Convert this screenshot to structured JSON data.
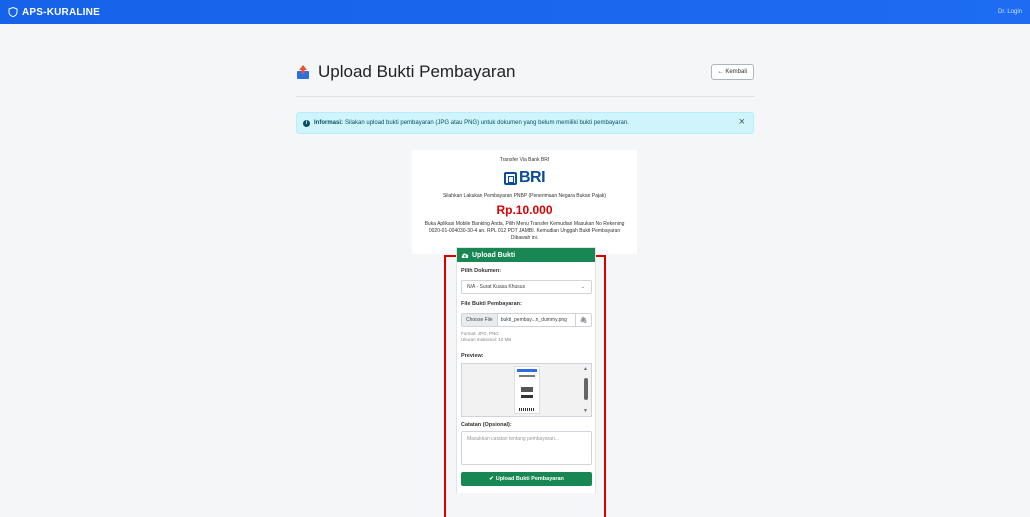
{
  "navbar": {
    "brand": "APS-KURALINE",
    "user": "Dr. Login"
  },
  "header": {
    "title": "Upload Bukti Pembayaran",
    "back_label": "← Kembali"
  },
  "alert": {
    "prefix": "Informasi:",
    "message": "Silakan upload bukti pembayaran (JPG atau PNG) untuk dokumen yang belum memiliki bukti pembayaran.",
    "close": "×"
  },
  "payment": {
    "heading": "Transfer Via Bank BRI",
    "bank_logo": "BRI",
    "description": "Silahkan Lakukan Pembayaran PNBP (Penerimaan Negara Bukan Pajak)",
    "amount": "Rp.10.000",
    "instructions": "Buka Aplikasi Mobile Banking Anda, Pilih Menu Transfer Kemudian Masukan No Rekening 0020-01-004030-30-4 an. RPL 012 PDT JAMBI. Kemudian Unggah Bukti Pembayaran Dibawah ini."
  },
  "upload_card": {
    "header": "Upload Bukti",
    "document_label": "Pilih Dokumen:",
    "document_value": "N/A - Surat Kuasa Khusus",
    "file_label": "File Bukti Pembayaran:",
    "choose_file": "Choose File",
    "file_name": "bukti_pembay...n_dummy.png",
    "hint_format": "Format: JPG, PNG",
    "hint_size": "Ukuran maksimal: 10 MB",
    "preview_label": "Preview:",
    "notes_label": "Catatan (Opsional):",
    "notes_placeholder": "Masukkan catatan tentang pembayaran...",
    "submit_label": "Upload Bukti Pembayaran"
  },
  "colors": {
    "navbar": "#1662e8",
    "success": "#198754",
    "alert_bg": "#cff4fc",
    "highlight": "#d90000",
    "amount": "#dd0000"
  }
}
